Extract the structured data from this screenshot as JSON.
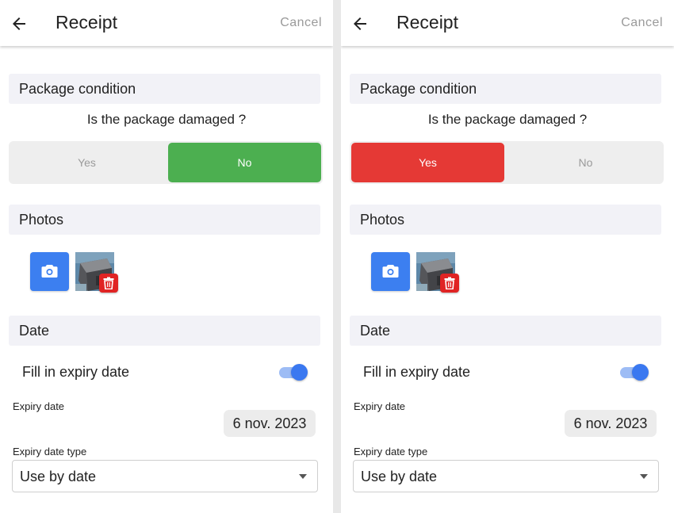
{
  "screens": [
    {
      "header": {
        "title": "Receipt",
        "cancel_label": "Cancel"
      },
      "package": {
        "section_title": "Package condition",
        "question": "Is the package damaged ?",
        "yes_label": "Yes",
        "no_label": "No",
        "selected": "No"
      },
      "photos": {
        "section_title": "Photos",
        "photo_count": 1
      },
      "date": {
        "section_title": "Date",
        "toggle_label": "Fill in expiry date",
        "toggle_on": true,
        "expiry_label": "Expiry date",
        "expiry_value": "6 nov. 2023",
        "type_label": "Expiry date type",
        "type_value": "Use by date"
      }
    },
    {
      "header": {
        "title": "Receipt",
        "cancel_label": "Cancel"
      },
      "package": {
        "section_title": "Package condition",
        "question": "Is the package damaged ?",
        "yes_label": "Yes",
        "no_label": "No",
        "selected": "Yes"
      },
      "photos": {
        "section_title": "Photos",
        "photo_count": 1
      },
      "date": {
        "section_title": "Date",
        "toggle_label": "Fill in expiry date",
        "toggle_on": true,
        "expiry_label": "Expiry date",
        "expiry_value": "6 nov. 2023",
        "type_label": "Expiry date type",
        "type_value": "Use by date"
      }
    }
  ],
  "colors": {
    "no_selected": "#4caf50",
    "yes_selected": "#e53935",
    "camera_button": "#3c7ff0",
    "delete_button": "#e02424",
    "toggle_on": "#3a78f0"
  },
  "icons": {
    "back": "arrow-left-icon",
    "camera": "camera-icon",
    "delete": "trash-icon",
    "dropdown": "caret-down-icon"
  }
}
